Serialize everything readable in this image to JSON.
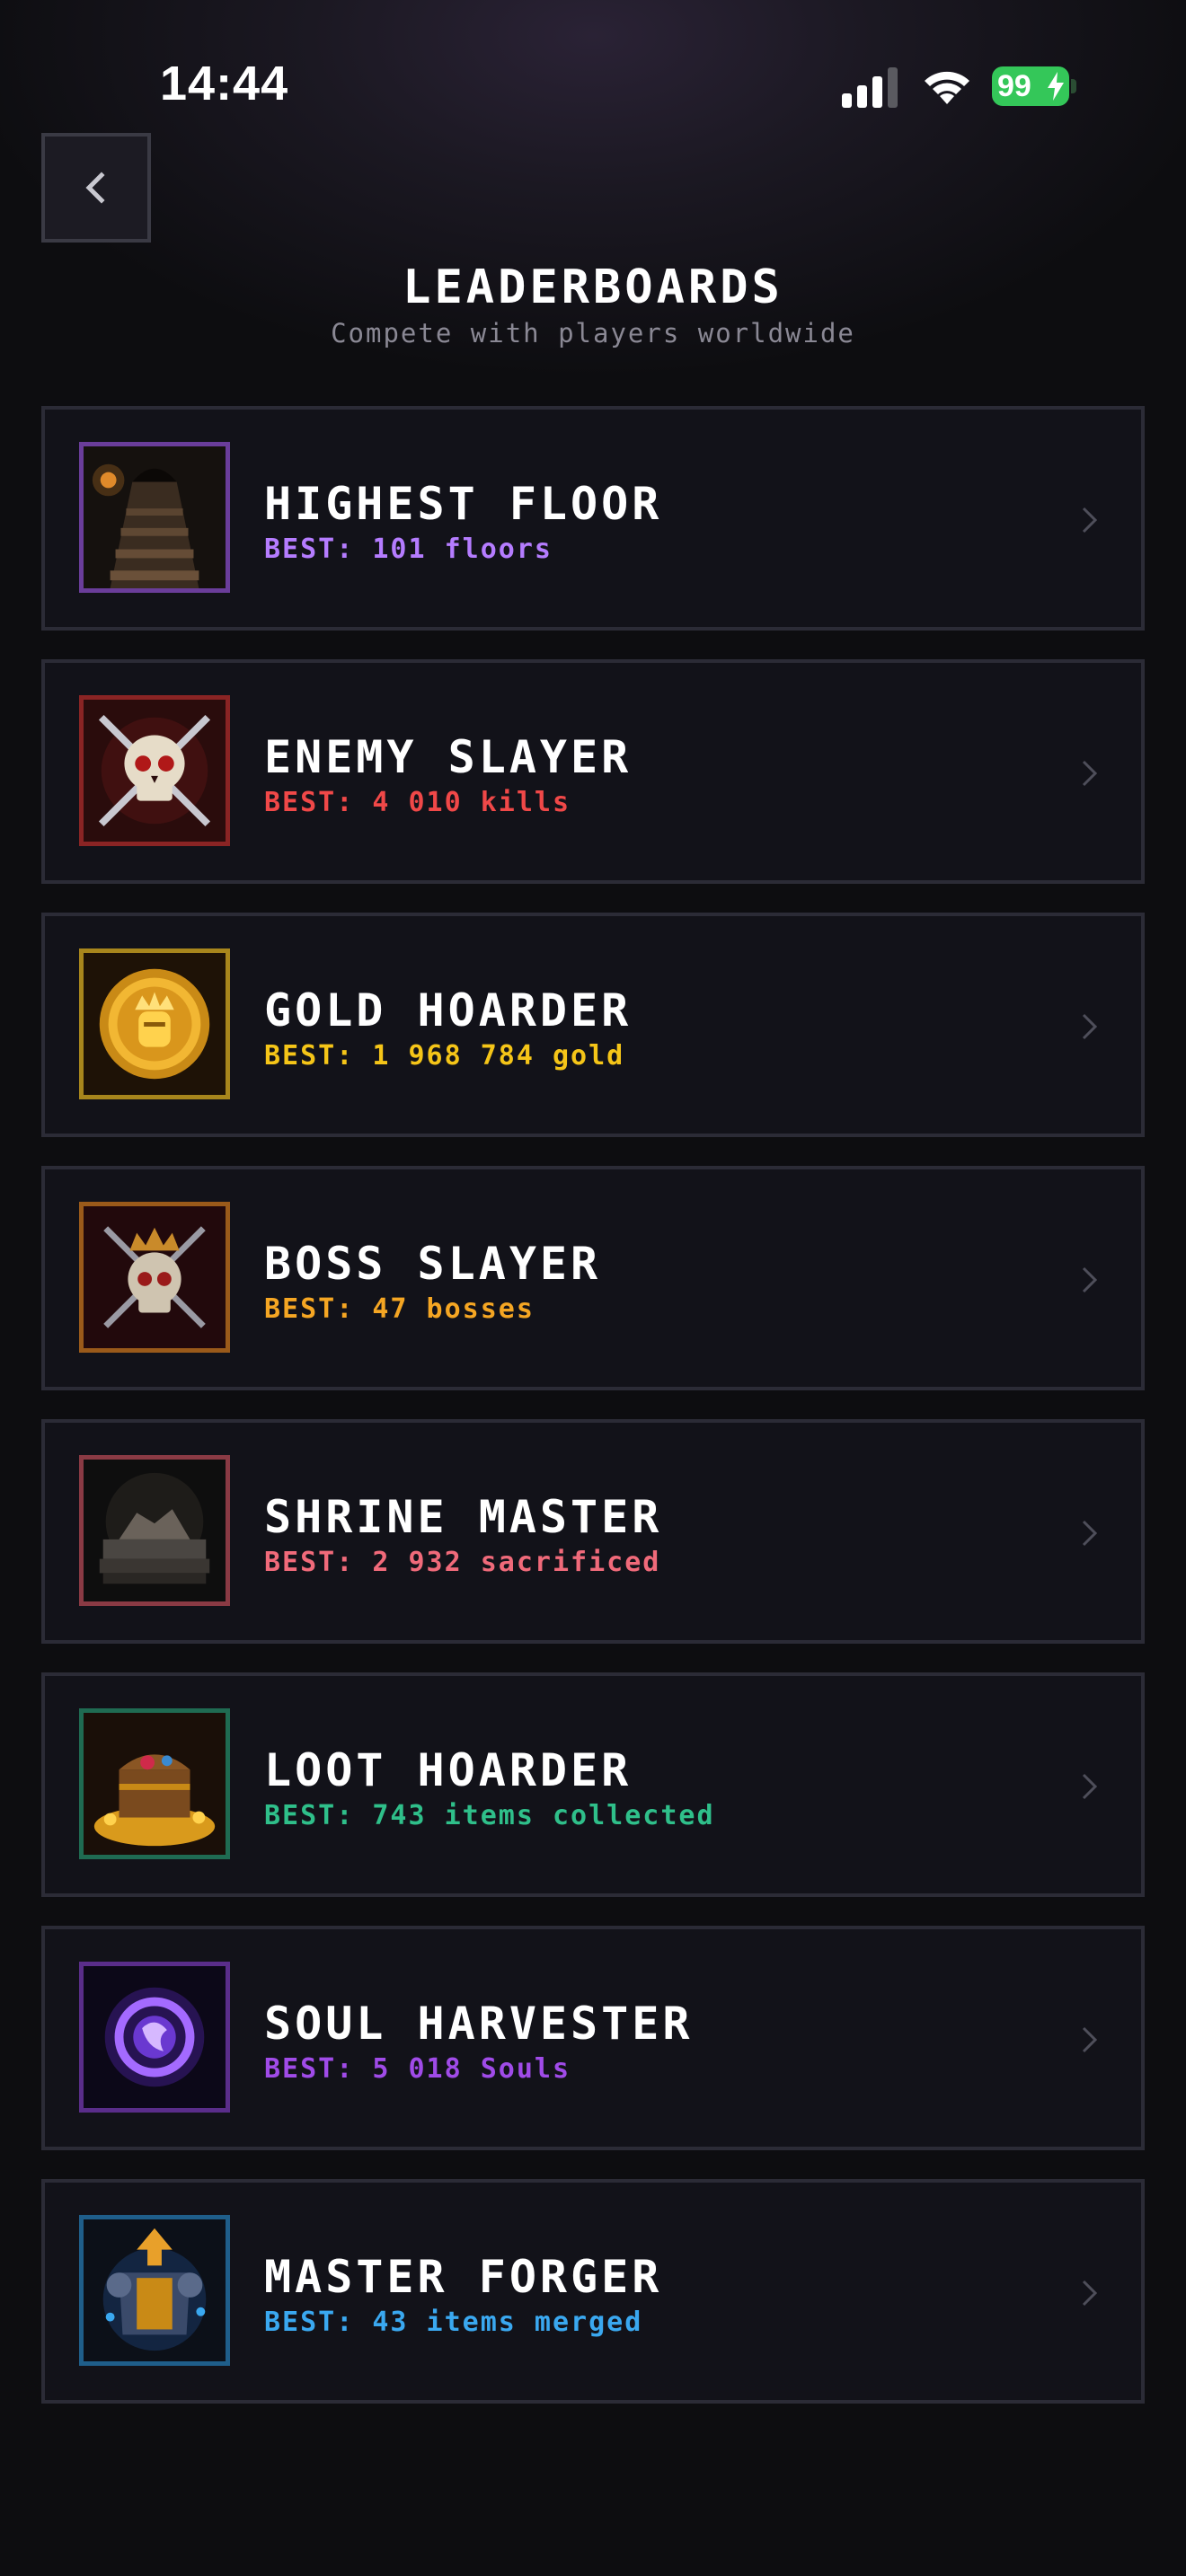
{
  "status_bar": {
    "time": "14:44",
    "battery": "99",
    "icons": [
      "cellular-signal-icon",
      "wifi-icon",
      "battery-charging-icon"
    ]
  },
  "header": {
    "back_icon": "chevron-left-icon",
    "title": "LEADERBOARDS",
    "subtitle": "Compete with players worldwide"
  },
  "leaderboards": [
    {
      "title": "HIGHEST FLOOR",
      "best": "BEST: 101 floors",
      "color": "#b57cff",
      "icon": "dungeon-stairs-icon"
    },
    {
      "title": "ENEMY SLAYER",
      "best": "BEST: 4 010 kills",
      "color": "#f04848",
      "icon": "skull-crossed-swords-icon"
    },
    {
      "title": "GOLD HOARDER",
      "best": "BEST: 1 968 784 gold",
      "color": "#f5c518",
      "icon": "gold-coin-icon"
    },
    {
      "title": "BOSS SLAYER",
      "best": "BEST: 47 bosses",
      "color": "#f5a623",
      "icon": "crowned-skull-icon"
    },
    {
      "title": "SHRINE MASTER",
      "best": "BEST: 2 932 sacrificed",
      "color": "#f06a7a",
      "icon": "shrine-altar-icon"
    },
    {
      "title": "LOOT HOARDER",
      "best": "BEST: 743 items collected",
      "color": "#2fbf8a",
      "icon": "treasure-chest-icon"
    },
    {
      "title": "SOUL HARVESTER",
      "best": "BEST: 5 018 Souls",
      "color": "#a04be8",
      "icon": "soul-orb-icon"
    },
    {
      "title": "MASTER FORGER",
      "best": "BEST: 43 items merged",
      "color": "#3aa8f0",
      "icon": "forged-armor-icon"
    }
  ],
  "icon_border_colors": [
    "#6a3d9a",
    "#8a2424",
    "#a8861c",
    "#9a5a1a",
    "#8a3a44",
    "#1f6b52",
    "#5a2d8a",
    "#1f5e8a"
  ]
}
